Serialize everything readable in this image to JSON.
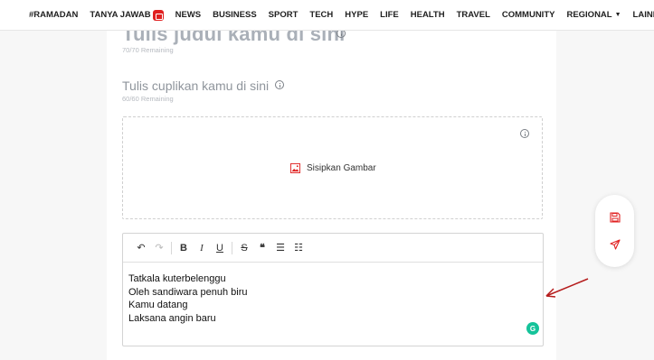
{
  "nav": {
    "items": [
      {
        "label": "#RAMADAN"
      },
      {
        "label": "TANYA JAWAB",
        "badge": true
      },
      {
        "label": "NEWS"
      },
      {
        "label": "BUSINESS"
      },
      {
        "label": "SPORT"
      },
      {
        "label": "TECH"
      },
      {
        "label": "HYPE"
      },
      {
        "label": "LIFE"
      },
      {
        "label": "HEALTH"
      },
      {
        "label": "TRAVEL"
      },
      {
        "label": "COMMUNITY"
      },
      {
        "label": "REGIONAL",
        "dropdown": true
      },
      {
        "label": "LAINNYA",
        "dropdown": true
      }
    ]
  },
  "form": {
    "title_placeholder": "Tulis judul kamu di sini",
    "title_counter": "70/70 Remaining",
    "excerpt_placeholder": "Tulis cuplikan kamu di sini",
    "excerpt_counter": "60/60 Remaining",
    "image_label": "Sisipkan Gambar"
  },
  "editor": {
    "lines": [
      "Tatkala kuterbelenggu",
      "Oleh sandiwara penuh biru",
      "Kamu datang",
      "Laksana angin baru"
    ],
    "toolbar": {
      "undo": "↶",
      "redo": "↷",
      "bold": "B",
      "italic": "I",
      "underline": "U",
      "strike": "S",
      "quote": "❝",
      "bullet_list": "☰",
      "ordered_list": "☷"
    },
    "grammarly_label": "G"
  },
  "colors": {
    "accent_red": "#e02020",
    "grammarly_green": "#15c39a",
    "annotation_arrow": "#b51c1c"
  },
  "icons": {
    "save": "save-icon",
    "send": "send-icon",
    "image": "image-icon",
    "info": "info-icon"
  }
}
